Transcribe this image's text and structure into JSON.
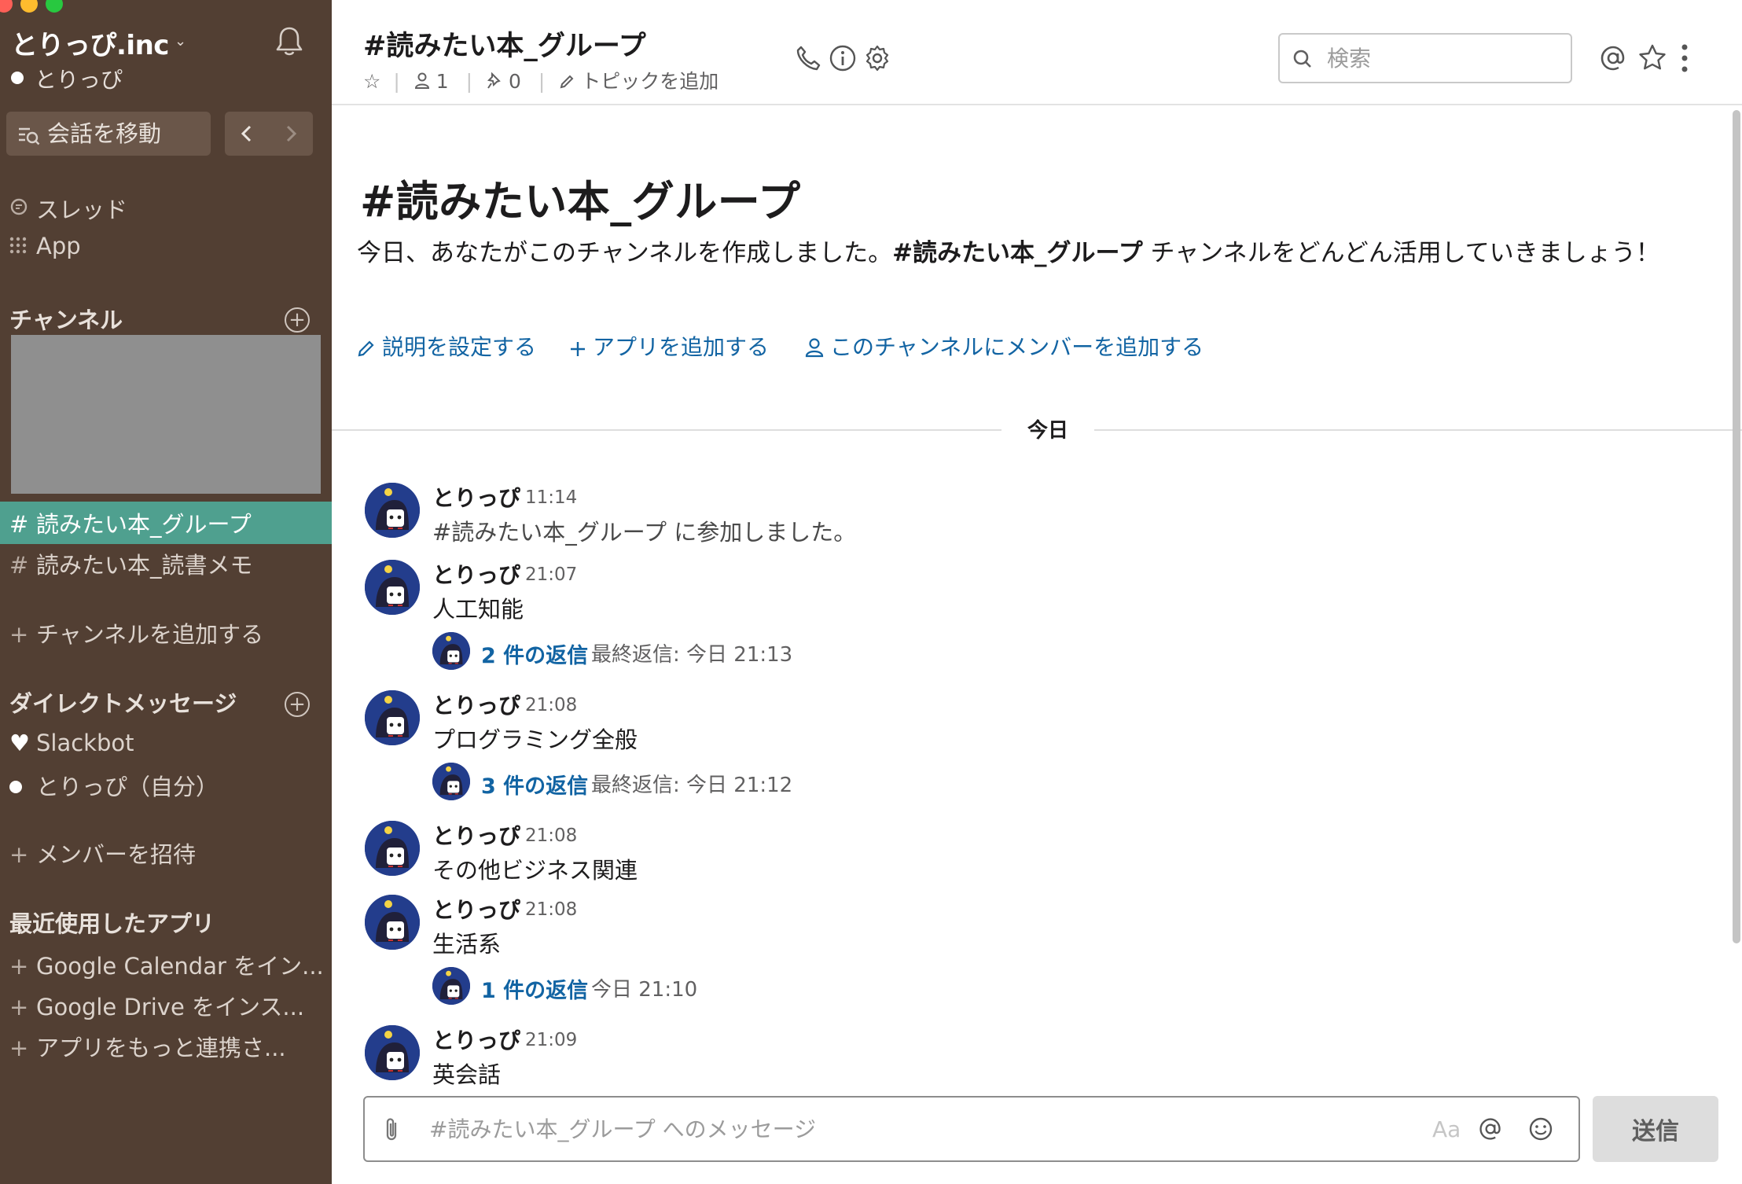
{
  "colors": {
    "sidebar_bg": "#523f33",
    "active_channel_bg": "#4fa08f",
    "link": "#1264a3",
    "traffic_close": "#ff5f57",
    "traffic_min": "#febc2e",
    "traffic_max": "#28c840"
  },
  "sidebar": {
    "workspace_name": "とりっぴ.inc",
    "user_name": "とりっぴ",
    "jump_label": "会話を移動",
    "nav_items": [
      {
        "icon": "threads-icon",
        "label": "スレッド"
      },
      {
        "icon": "apps-grid-icon",
        "label": "App"
      }
    ],
    "channels_heading": "チャンネル",
    "channels": [
      {
        "prefix": "#",
        "label": "読みたい本_グループ",
        "active": true
      },
      {
        "prefix": "#",
        "label": "読みたい本_読書メモ",
        "active": false
      }
    ],
    "add_channel": "チャンネルを追加する",
    "dm_heading": "ダイレクトメッセージ",
    "dms": [
      {
        "icon": "heart-icon",
        "label": "Slackbot"
      },
      {
        "icon": "presence-dot-icon",
        "label": "とりっぴ（自分）"
      }
    ],
    "invite": "メンバーを招待",
    "apps_heading": "最近使用したアプリ",
    "apps": [
      "Google Calendar をイン...",
      "Google Drive をインス...",
      "アプリをもっと連携さ..."
    ],
    "plus": "+"
  },
  "header": {
    "channel_name": "#読みたい本_グループ",
    "members_count": "1",
    "pins_count": "0",
    "topic_placeholder": "トピックを追加",
    "search_placeholder": "検索",
    "icons": [
      "phone-icon",
      "info-icon",
      "gear-icon",
      "at-icon",
      "star-icon",
      "more-icon"
    ]
  },
  "intro": {
    "title": "#読みたい本_グループ",
    "text_before": "今日、あなたがこのチャンネルを作成しました。",
    "text_bold": "#読みたい本_グループ",
    "text_after": " チャンネルをどんどん活用していきましょう！",
    "links": [
      {
        "icon": "pencil-icon",
        "label": "説明を設定する"
      },
      {
        "icon": "plus-icon",
        "label": "アプリを追加する"
      },
      {
        "icon": "person-icon",
        "label": "このチャンネルにメンバーを追加する"
      }
    ]
  },
  "day_divider": "今日",
  "messages": [
    {
      "name": "とりっぴ",
      "time": "11:14",
      "text": "#読みたい本_グループ に参加しました。"
    },
    {
      "name": "とりっぴ",
      "time": "21:07",
      "text": "人工知能",
      "replies": "2 件の返信",
      "last_reply": "最終返信: 今日 21:13"
    },
    {
      "name": "とりっぴ",
      "time": "21:08",
      "text": "プログラミング全般",
      "replies": "3 件の返信",
      "last_reply": "最終返信: 今日 21:12"
    },
    {
      "name": "とりっぴ",
      "time": "21:08",
      "text": "その他ビジネス関連"
    },
    {
      "name": "とりっぴ",
      "time": "21:08",
      "text": "生活系",
      "replies": "1 件の返信",
      "last_reply": "今日 21:10"
    },
    {
      "name": "とりっぴ",
      "time": "21:09",
      "text": "英会話"
    }
  ],
  "composer": {
    "placeholder": "#読みたい本_グループ へのメッセージ",
    "format_label": "Aa",
    "send_label": "送信"
  }
}
